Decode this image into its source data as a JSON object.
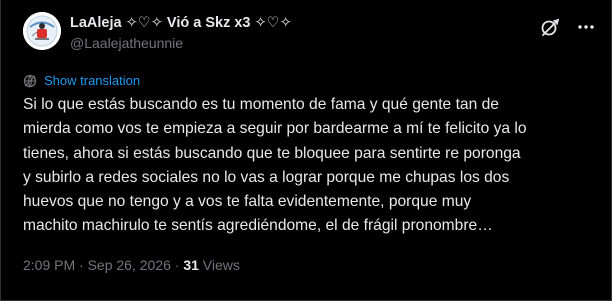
{
  "user": {
    "display_name": "LaAleja ✧♡✧ Vió a Skz x3 ✧♡✧",
    "handle": "@Laalejatheunnie"
  },
  "translate": {
    "label": "Show translation"
  },
  "tweet": {
    "lines": [
      "Si lo que estás buscando es tu momento de fama y qué gente tan de",
      "mierda como vos te empieza a seguir por bardearme a mí te felicito ya lo",
      "tienes, ahora si estás buscando que te bloquee para sentirte re poronga",
      "y subirlo a redes sociales no lo vas a lograr porque me chupas los dos",
      "huevos que no tengo y a vos te falta evidentemente, porque muy",
      "machito machirulo te sentís agrediéndome, el de frágil pronombre…"
    ]
  },
  "meta": {
    "time": "2:09 PM",
    "separator1": " · ",
    "date": "Sep 26, 2026",
    "separator2": " · ",
    "views_count": "31",
    "views_label": " Views"
  },
  "icons": {
    "grok": "grok-icon",
    "more": "more-icon",
    "translate": "globe-icon"
  },
  "colors": {
    "background": "#000000",
    "text": "#e7e9ea",
    "secondary": "#71767b",
    "link": "#1d9bf0"
  }
}
